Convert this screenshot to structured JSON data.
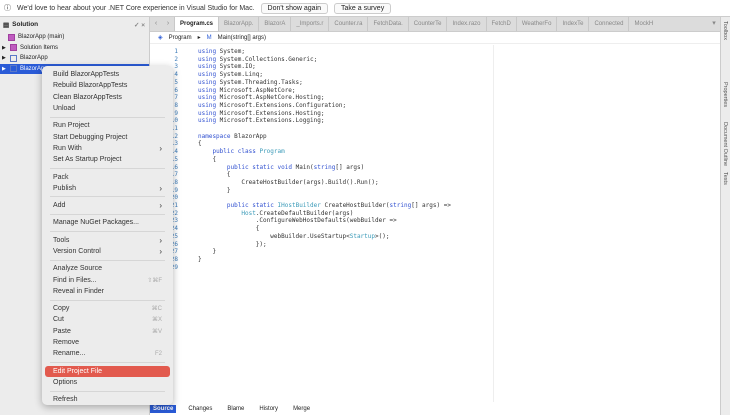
{
  "infobar": {
    "message": "We'd love to hear about your .NET Core experience in Visual Studio for Mac.",
    "dont_show": "Don't show again",
    "survey": "Take a survey"
  },
  "solution": {
    "title": "Solution",
    "items": [
      {
        "label": "BlazorApp (main)",
        "icon": "solution-icon"
      },
      {
        "label": "Solution Items",
        "icon": "folder-icon"
      },
      {
        "label": "BlazorApp",
        "icon": "project-icon"
      },
      {
        "label": "BlazorApp",
        "icon": "project-icon",
        "selected": true
      }
    ]
  },
  "tabs": [
    "Program.cs",
    "BlazorApp.",
    "BlazorA",
    "_Imports.r",
    "Counter.ra",
    "FetchData.",
    "CounterTe",
    "Index.razo",
    "FetchD",
    "WeatherFo",
    "IndexTe",
    "Connected",
    "MockH"
  ],
  "breadcrumb": {
    "class": "Program",
    "method": "Main(string[] args)"
  },
  "code": [
    "using System;",
    "using System.Collections.Generic;",
    "using System.IO;",
    "using System.Linq;",
    "using System.Threading.Tasks;",
    "using Microsoft.AspNetCore;",
    "using Microsoft.AspNetCore.Hosting;",
    "using Microsoft.Extensions.Configuration;",
    "using Microsoft.Extensions.Hosting;",
    "using Microsoft.Extensions.Logging;",
    "",
    "namespace BlazorApp",
    "{",
    "    public class Program",
    "    {",
    "        public static void Main(string[] args)",
    "        {",
    "            CreateHostBuilder(args).Build().Run();",
    "        }",
    "",
    "        public static IHostBuilder CreateHostBuilder(string[] args) =>",
    "            Host.CreateDefaultBuilder(args)",
    "                .ConfigureWebHostDefaults(webBuilder =>",
    "                {",
    "                    webBuilder.UseStartup<Startup>();",
    "                });",
    "    }",
    "}",
    ""
  ],
  "bottom_tabs": [
    "Source",
    "Changes",
    "Blame",
    "History",
    "Merge"
  ],
  "right_pads": [
    "Toolbox",
    "Properties",
    "Document Outline",
    "Tests"
  ],
  "menu": [
    [
      {
        "label": "Build BlazorAppTests"
      },
      {
        "label": "Rebuild BlazorAppTests"
      },
      {
        "label": "Clean BlazorAppTests"
      },
      {
        "label": "Unload"
      }
    ],
    [
      {
        "label": "Run Project"
      },
      {
        "label": "Start Debugging Project"
      },
      {
        "label": "Run With",
        "submenu": true
      },
      {
        "label": "Set As Startup Project"
      }
    ],
    [
      {
        "label": "Pack"
      },
      {
        "label": "Publish",
        "submenu": true
      }
    ],
    [
      {
        "label": "Add",
        "submenu": true
      }
    ],
    [
      {
        "label": "Manage NuGet Packages..."
      }
    ],
    [
      {
        "label": "Tools",
        "submenu": true
      },
      {
        "label": "Version Control",
        "submenu": true
      }
    ],
    [
      {
        "label": "Analyze Source"
      },
      {
        "label": "Find in Files...",
        "shortcut": "⇧⌘F"
      },
      {
        "label": "Reveal in Finder"
      }
    ],
    [
      {
        "label": "Copy",
        "shortcut": "⌘C"
      },
      {
        "label": "Cut",
        "shortcut": "⌘X"
      },
      {
        "label": "Paste",
        "shortcut": "⌘V"
      },
      {
        "label": "Remove"
      },
      {
        "label": "Rename...",
        "shortcut": "F2"
      }
    ],
    [
      {
        "label": "Edit Project File",
        "highlighted": true
      },
      {
        "label": "Options"
      }
    ],
    [
      {
        "label": "Refresh"
      }
    ]
  ],
  "colors": {
    "accent": "#2a5bd7",
    "highlight": "#e25a4e"
  }
}
